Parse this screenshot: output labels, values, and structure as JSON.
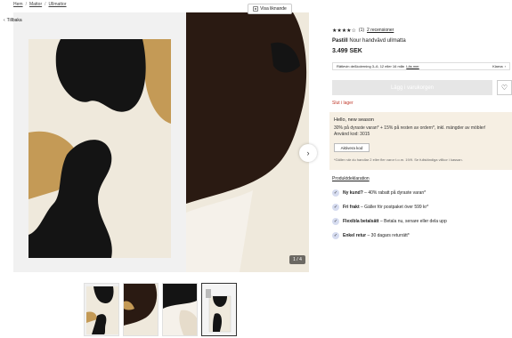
{
  "breadcrumb": [
    "Hem",
    "Mattor",
    "Ullmattor"
  ],
  "back_label": "Tillbaka",
  "gallery": {
    "similar_label": "Visa liknande",
    "counter": "1 / 4",
    "colors": {
      "cream": "#efe9dc",
      "black": "#141414",
      "tan": "#c49a56",
      "brown": "#2a1a12"
    }
  },
  "product": {
    "rating_count": "(1)",
    "reviews_link": "2 recensioner",
    "brand": "Pastill",
    "name": "Nour handvävd ullmatta",
    "price": "3.499 SEK"
  },
  "delivery": {
    "text": "Rätlevin deßkolerning 3–6, 12 eller 16 mån",
    "link": "Läs mer",
    "right": "Klarna"
  },
  "cart_button": "Lägg i varukorgen",
  "stock_status": "Slut i lager",
  "promo": {
    "title": "Hello, new season",
    "line1": "30% på dyraste varan* + 15% på resten av ordern*, inkl. mängder av möbler!",
    "line2": "Använd kod: 3015",
    "button": "Aktivera kod",
    "note": "*Gäller när du handlar 2 eller fler varor t.o.m. 19/9. Se fullständiga villkor i kassan."
  },
  "details_link": "Produktdeklaration",
  "usps": [
    {
      "name": "Ny kund?",
      "desc": " – 40% rabatt på dyraste varan*"
    },
    {
      "name": "Fri frakt",
      "desc": " – Gäller för postpaket över 599 kr*"
    },
    {
      "name": "Flexibla betalsätt",
      "desc": " – Betala nu, senare eller dela upp"
    },
    {
      "name": "Enkel retur",
      "desc": " – 30 dagars returrätt*"
    }
  ]
}
